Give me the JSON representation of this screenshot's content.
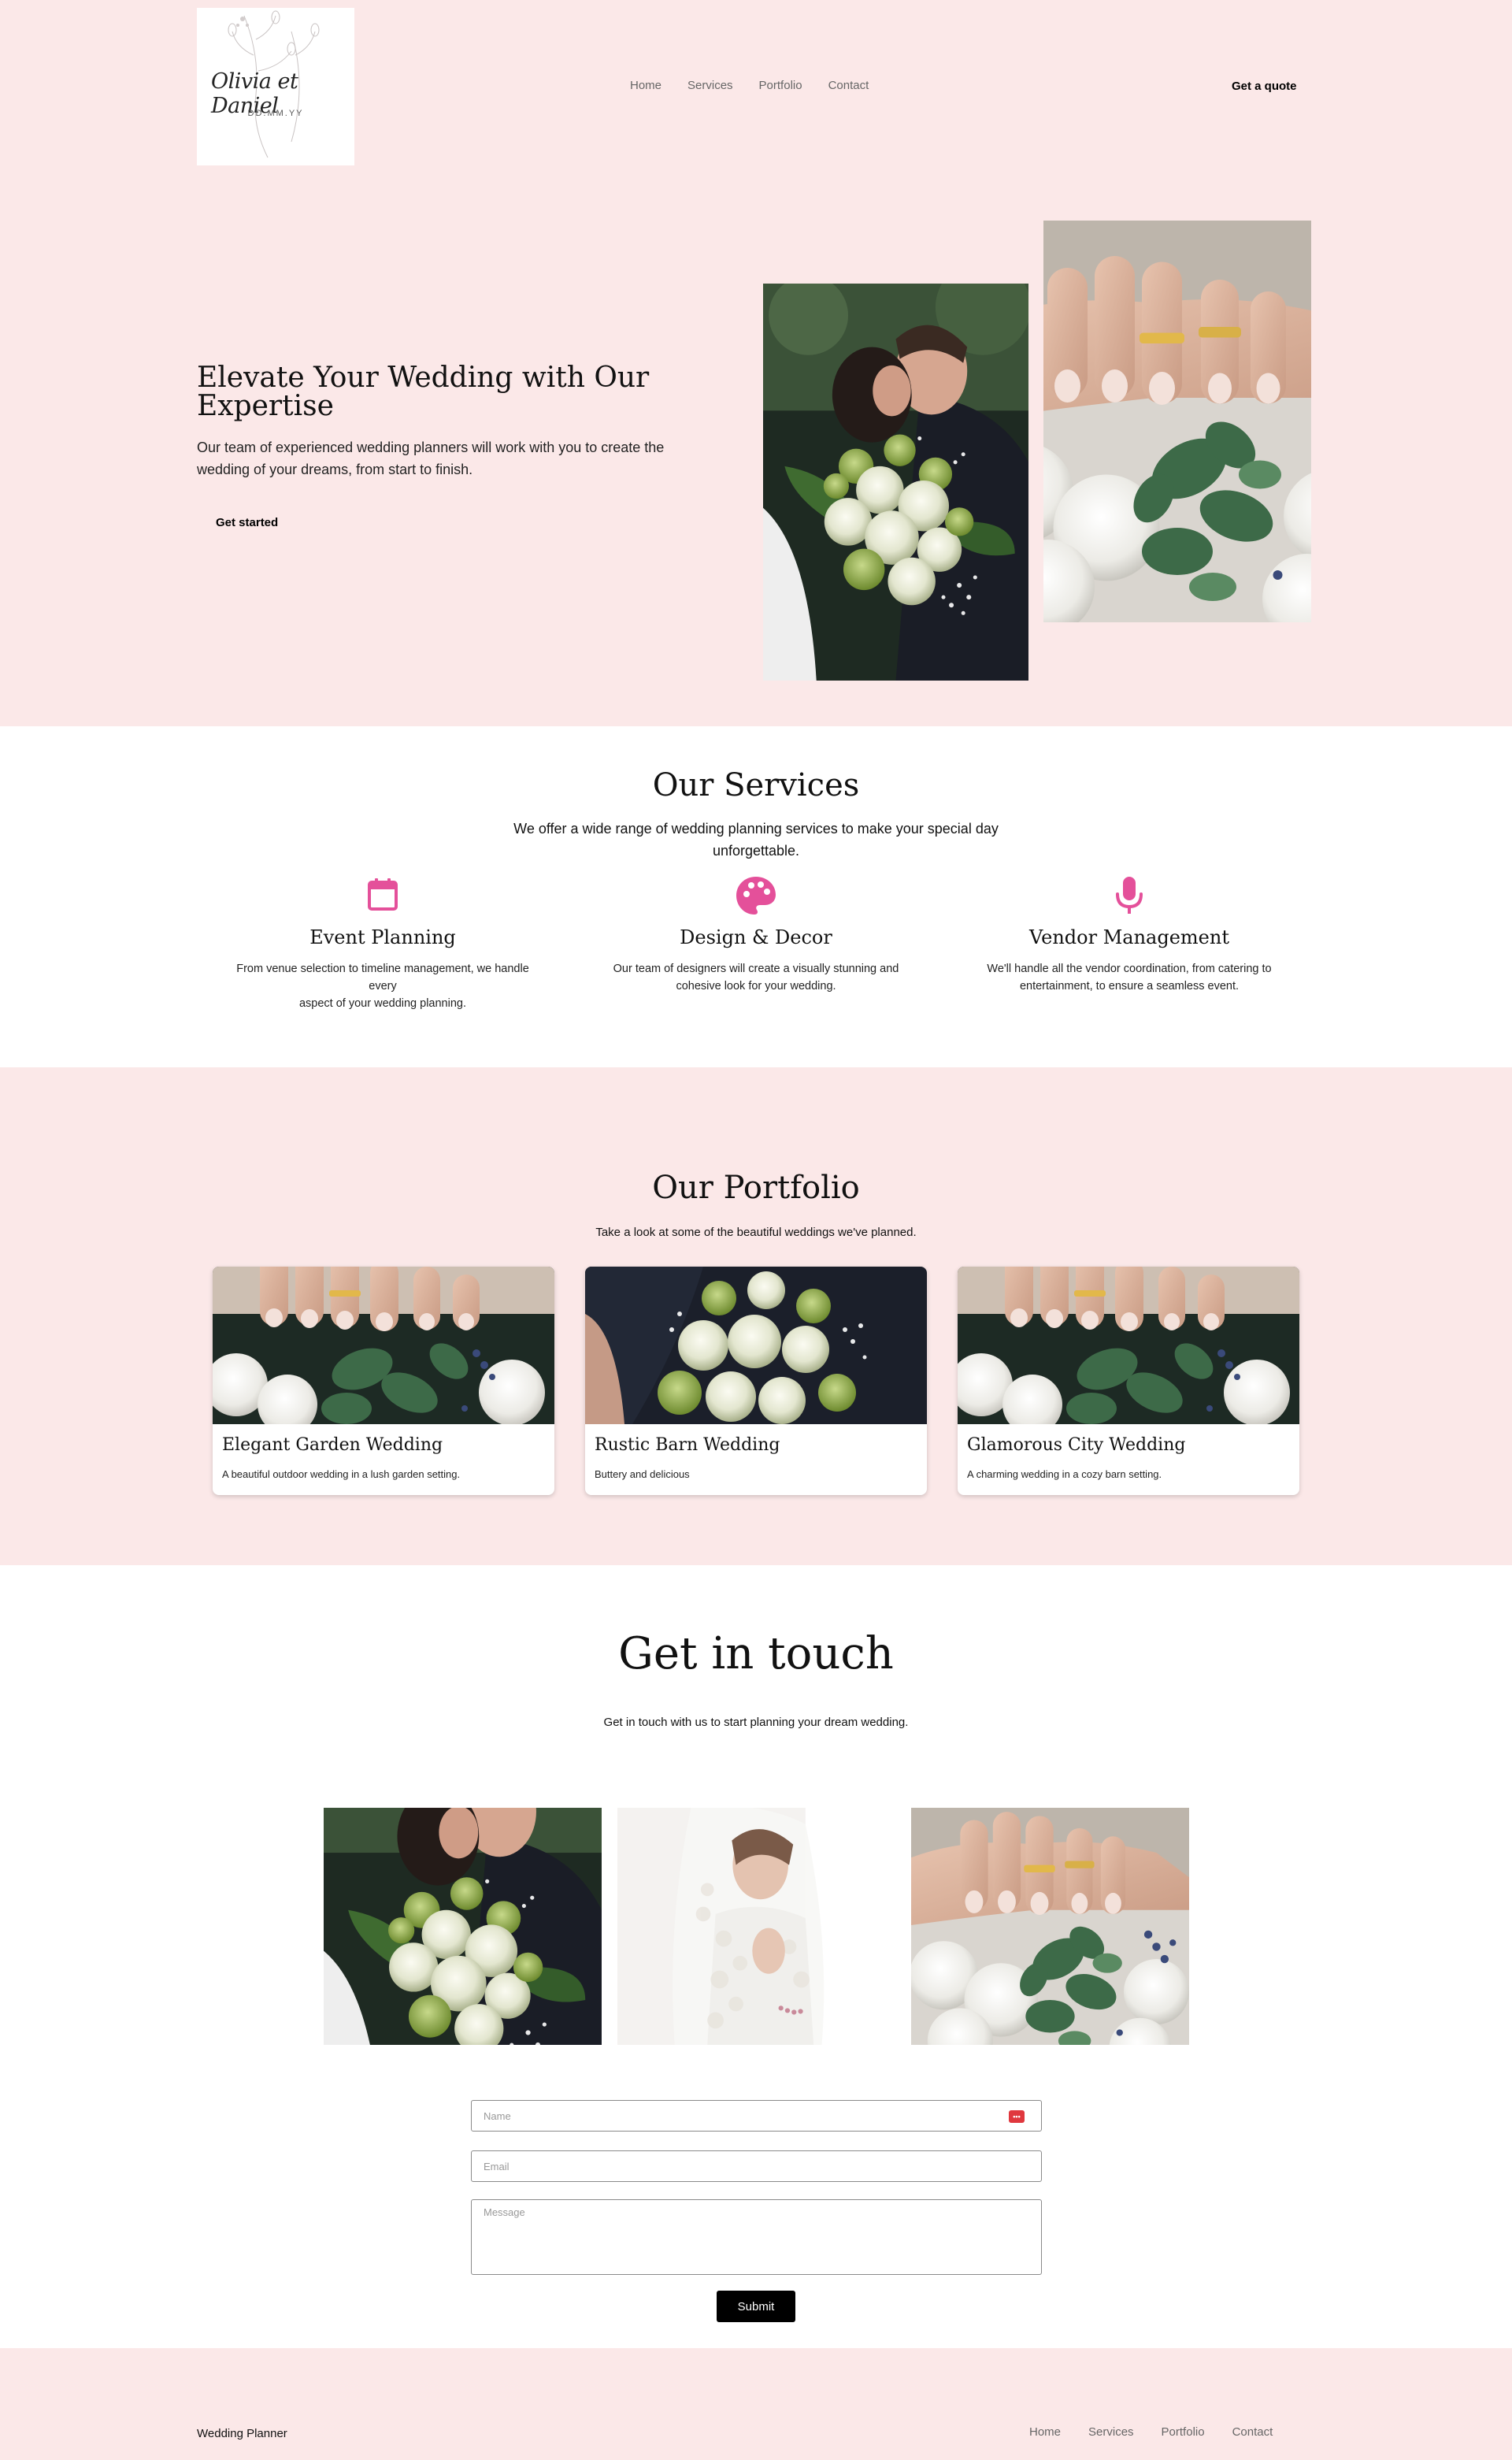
{
  "header": {
    "logo": {
      "script": "Olivia et Daniel",
      "date": "DD.MM.YY"
    },
    "nav": [
      "Home",
      "Services",
      "Portfolio",
      "Contact"
    ],
    "cta": "Get a quote"
  },
  "hero": {
    "title": "Elevate Your Wedding with Our Expertise",
    "subtitle": "Our team of experienced wedding planners will work with you to create the wedding of your dreams, from start to finish.",
    "button": "Get started"
  },
  "services": {
    "title": "Our Services",
    "subtitle": "We offer a wide range of wedding planning services to make your special day unforgettable.",
    "items": [
      {
        "icon": "calendar-icon",
        "title": "Event Planning",
        "desc": "From venue selection to timeline management, we handle every\naspect of your wedding planning."
      },
      {
        "icon": "palette-icon",
        "title": "Design & Decor",
        "desc": "Our team of designers will create a visually stunning and\ncohesive look for your wedding."
      },
      {
        "icon": "microphone-icon",
        "title": "Vendor Management",
        "desc": "We'll handle all the vendor coordination, from catering to\nentertainment, to ensure a seamless event."
      }
    ],
    "accent": "#e4509a"
  },
  "portfolio": {
    "title": "Our Portfolio",
    "subtitle": "Take a look at some of the beautiful weddings we've planned.",
    "cards": [
      {
        "title": "Elegant Garden Wedding",
        "desc": "A beautiful outdoor wedding in a lush garden setting."
      },
      {
        "title": "Rustic Barn Wedding",
        "desc": "Buttery and delicious"
      },
      {
        "title": "Glamorous City Wedding",
        "desc": "A charming wedding in a cozy barn setting."
      }
    ]
  },
  "contact": {
    "title": "Get in touch",
    "subtitle": "Get in touch with us to start planning your dream wedding.",
    "form": {
      "name_placeholder": "Name",
      "email_placeholder": "Email",
      "message_placeholder": "Message",
      "submit": "Submit"
    }
  },
  "footer": {
    "brand": "Wedding Planner",
    "nav": [
      "Home",
      "Services",
      "Portfolio",
      "Contact"
    ]
  },
  "colors": {
    "pink_bg": "#fbe8e8",
    "accent": "#e4509a",
    "button": "#000000"
  }
}
